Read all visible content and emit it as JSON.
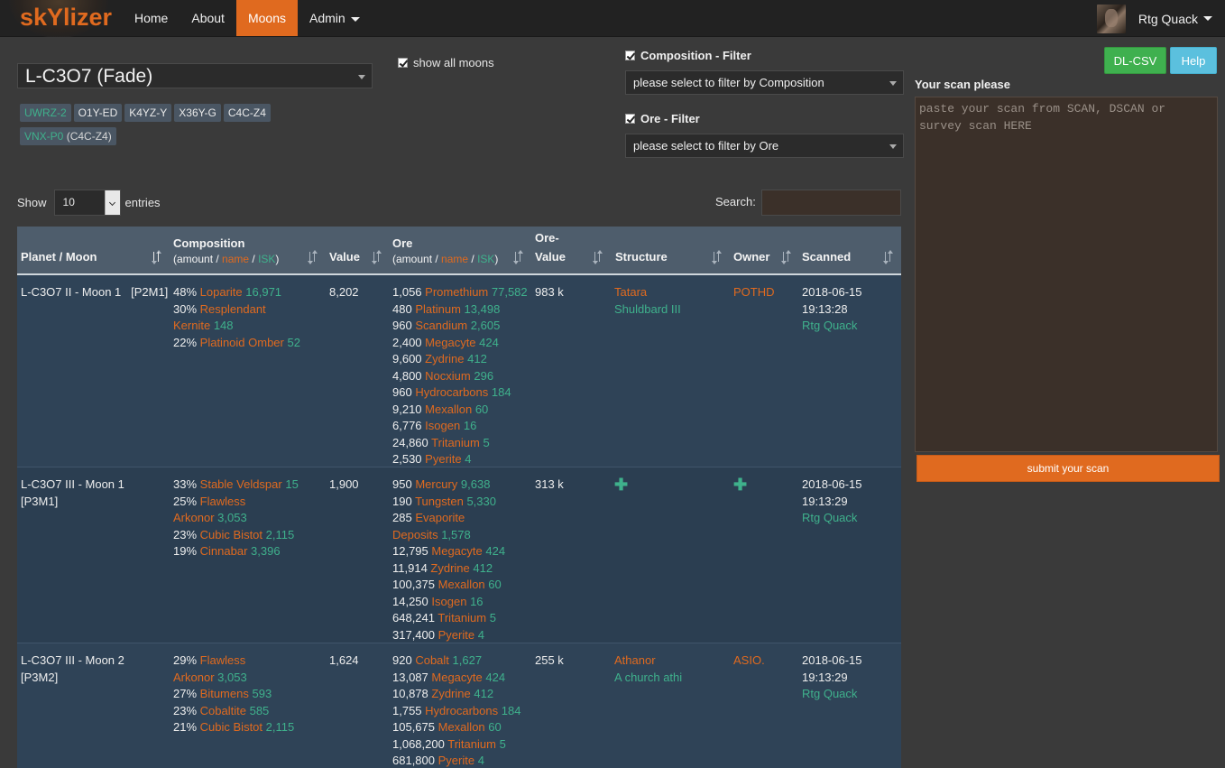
{
  "brand": {
    "name": "skYlizer"
  },
  "nav": {
    "home": "Home",
    "about": "About",
    "moons": "Moons",
    "admin": "Admin"
  },
  "user": {
    "name": "Rtg Quack"
  },
  "moon_select": {
    "value": "L-C3O7 (Fade)"
  },
  "systems": [
    "UWRZ-2",
    "O1Y-ED",
    "K4YZ-Y",
    "X36Y-G",
    "C4C-Z4"
  ],
  "system_extra": {
    "name": "VNX-P0",
    "sub": "(C4C-Z4)"
  },
  "show_all_moons": {
    "label": "show all moons",
    "checked": true
  },
  "filters": {
    "composition": {
      "label": "Composition - Filter",
      "placeholder": "please select to filter by Composition"
    },
    "ore": {
      "label": "Ore - Filter",
      "placeholder": "please select to filter by Ore"
    }
  },
  "buttons": {
    "dl_csv": "DL-CSV",
    "help": "Help",
    "submit": "submit your scan"
  },
  "scan": {
    "title": "Your scan please",
    "placeholder": "paste your scan from SCAN, DSCAN or survey scan HERE"
  },
  "table_controls": {
    "show": "Show",
    "entries_value": "10",
    "entries": "entries",
    "search": "Search:"
  },
  "columns": {
    "planet_moon": "Planet / Moon",
    "composition": "Composition",
    "value": "Value",
    "ore": "Ore",
    "ore_value_1": "Ore-",
    "ore_value_2": "Value",
    "structure": "Structure",
    "owner": "Owner",
    "scanned": "Scanned",
    "sub_amount": "(amount / ",
    "sub_name": "name",
    "sub_sep": " / ",
    "sub_isk": "ISK",
    "sub_end": ")"
  },
  "rows": [
    {
      "moon": [
        "L-C3O7 II - Moon 1   [P2M1]"
      ],
      "composition": [
        {
          "pct": "48%",
          "name": "Loparite",
          "isk": "16,971"
        },
        {
          "pct": "30%",
          "name": "Resplendant",
          "cont": "Kernite",
          "isk": "148"
        },
        {
          "pct": "22%",
          "name": "Platinoid Omber",
          "isk": "52"
        }
      ],
      "value": "8,202",
      "ore": [
        {
          "amt": "1,056",
          "name": "Promethium",
          "isk": "77,582"
        },
        {
          "amt": "480",
          "name": "Platinum",
          "isk": "13,498"
        },
        {
          "amt": "960",
          "name": "Scandium",
          "isk": "2,605"
        },
        {
          "amt": "2,400",
          "name": "Megacyte",
          "isk": "424"
        },
        {
          "amt": "9,600",
          "name": "Zydrine",
          "isk": "412"
        },
        {
          "amt": "4,800",
          "name": "Nocxium",
          "isk": "296"
        },
        {
          "amt": "960",
          "name": "Hydrocarbons",
          "isk": "184"
        },
        {
          "amt": "9,210",
          "name": "Mexallon",
          "isk": "60"
        },
        {
          "amt": "6,776",
          "name": "Isogen",
          "isk": "16"
        },
        {
          "amt": "24,860",
          "name": "Tritanium",
          "isk": "5"
        },
        {
          "amt": "2,530",
          "name": "Pyerite",
          "isk": "4"
        }
      ],
      "ore_value": "983 k",
      "structure": {
        "name": "Tatara",
        "sub": "Shuldbard III"
      },
      "owner": "POTHD",
      "scanned": {
        "date": "2018-06-15",
        "time": "19:13:28",
        "by": "Rtg Quack"
      }
    },
    {
      "moon": [
        "L-C3O7 III - Moon 1",
        "[P3M1]"
      ],
      "composition": [
        {
          "pct": "33%",
          "name": "Stable Veldspar",
          "isk": "15"
        },
        {
          "pct": "25%",
          "name": "Flawless",
          "cont": "Arkonor",
          "isk": "3,053"
        },
        {
          "pct": "23%",
          "name": "Cubic Bistot",
          "isk": "2,115"
        },
        {
          "pct": "19%",
          "name": "Cinnabar",
          "isk": "3,396"
        }
      ],
      "value": "1,900",
      "ore": [
        {
          "amt": "950",
          "name": "Mercury",
          "isk": "9,638"
        },
        {
          "amt": "190",
          "name": "Tungsten",
          "isk": "5,330"
        },
        {
          "amt": "285",
          "name": "Evaporite",
          "cont": "Deposits",
          "isk": "1,578"
        },
        {
          "amt": "12,795",
          "name": "Megacyte",
          "isk": "424"
        },
        {
          "amt": "11,914",
          "name": "Zydrine",
          "isk": "412"
        },
        {
          "amt": "100,375",
          "name": "Mexallon",
          "isk": "60"
        },
        {
          "amt": "14,250",
          "name": "Isogen",
          "isk": "16"
        },
        {
          "amt": "648,241",
          "name": "Tritanium",
          "isk": "5"
        },
        {
          "amt": "317,400",
          "name": "Pyerite",
          "isk": "4"
        }
      ],
      "ore_value": "313 k",
      "structure": {
        "name": "",
        "sub": ""
      },
      "owner": "",
      "add_icons": true,
      "scanned": {
        "date": "2018-06-15",
        "time": "19:13:29",
        "by": "Rtg Quack"
      }
    },
    {
      "moon": [
        "L-C3O7 III - Moon 2",
        "[P3M2]"
      ],
      "composition": [
        {
          "pct": "29%",
          "name": "Flawless",
          "cont": "Arkonor",
          "isk": "3,053"
        },
        {
          "pct": "27%",
          "name": "Bitumens",
          "isk": "593"
        },
        {
          "pct": "23%",
          "name": "Cobaltite",
          "isk": "585"
        },
        {
          "pct": "21%",
          "name": "Cubic Bistot",
          "isk": "2,115"
        }
      ],
      "value": "1,624",
      "ore": [
        {
          "amt": "920",
          "name": "Cobalt",
          "isk": "1,627"
        },
        {
          "amt": "13,087",
          "name": "Megacyte",
          "isk": "424"
        },
        {
          "amt": "10,878",
          "name": "Zydrine",
          "isk": "412"
        },
        {
          "amt": "1,755",
          "name": "Hydrocarbons",
          "isk": "184"
        },
        {
          "amt": "105,675",
          "name": "Mexallon",
          "isk": "60"
        },
        {
          "amt": "1,068,200",
          "name": "Tritanium",
          "isk": "5"
        },
        {
          "amt": "681,800",
          "name": "Pyerite",
          "isk": "4"
        }
      ],
      "ore_value": "255 k",
      "structure": {
        "name": "Athanor",
        "sub": "A church athi"
      },
      "owner": "ASIO.",
      "scanned": {
        "date": "2018-06-15",
        "time": "19:13:29",
        "by": "Rtg Quack"
      }
    }
  ],
  "colors": {
    "accent": "#e06a1f",
    "isk_green": "#3fb18c",
    "table_header": "#4e5d6c",
    "row_bg": "#2f4357"
  }
}
